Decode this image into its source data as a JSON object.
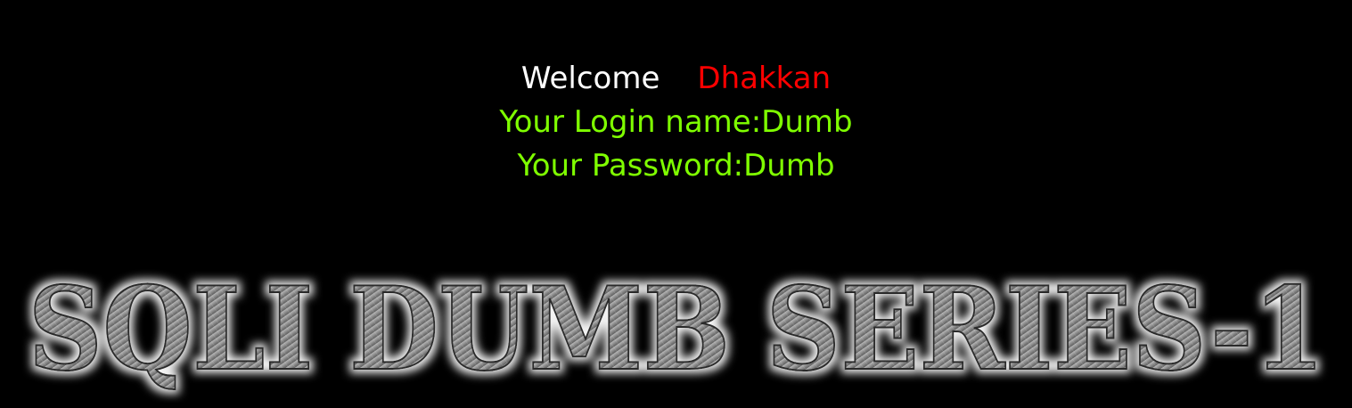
{
  "welcome": {
    "label": "Welcome",
    "username": "Dhakkan"
  },
  "login": {
    "name_line": "Your Login name:Dumb",
    "password_line": "Your Password:Dumb"
  },
  "banner": {
    "title": "SQLI DUMB SERIES-1"
  },
  "colors": {
    "background": "#000000",
    "welcome_text": "#ffffff",
    "username_text": "#ff0000",
    "info_text": "#7fff00",
    "banner_fill": "#8a8a8a"
  }
}
